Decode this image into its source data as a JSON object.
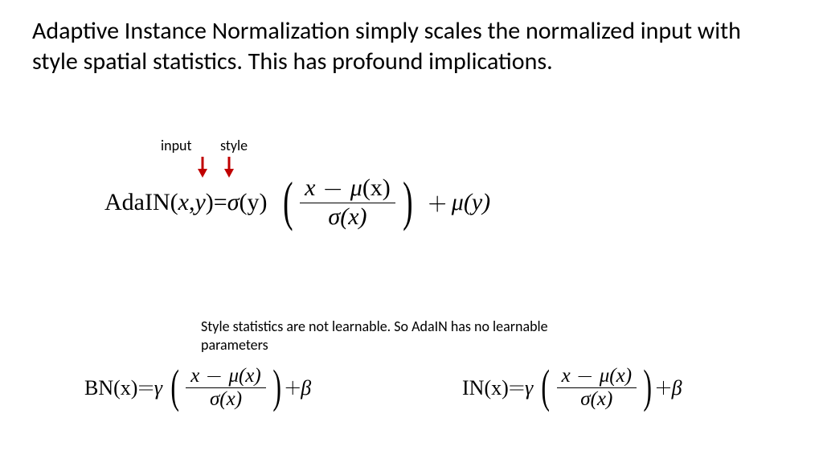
{
  "title": "Adaptive Instance Normalization simply scales the normalized input with style spatial statistics. This has profound implications.",
  "labels": {
    "input": "input",
    "style": "style"
  },
  "note": "Style statistics are not learnable. So AdaIN has no learnable parameters",
  "eq_main": {
    "fn": "AdaIN",
    "args_open": "(",
    "x": "x",
    "comma": ", ",
    "y": "y",
    "args_close": ")",
    "equals": " = ",
    "sigma": "σ",
    "of_y": "(y)",
    "num1": "x",
    "num_minus": " − ",
    "mu": "μ",
    "of_x": "(x)",
    "den_sigma_of_x": "σ(x)",
    "plus": " + ",
    "mu_of_y": "μ(y)"
  },
  "eq_bn": {
    "fn": "BN",
    "arg": "(x)",
    "equals": " = ",
    "gamma": "γ",
    "num_x": "x",
    "minus": " − ",
    "mu_of_x": "μ(x)",
    "den": "σ(x)",
    "plus": " + ",
    "beta": "β"
  },
  "eq_in": {
    "fn": "IN",
    "arg": "(x)",
    "equals": " = ",
    "gamma": "γ",
    "num_x": "x",
    "minus": " − ",
    "mu_of_x": "μ(x)",
    "den": "σ(x)",
    "plus": " + ",
    "beta": "β"
  },
  "colors": {
    "arrow": "#c00000"
  }
}
